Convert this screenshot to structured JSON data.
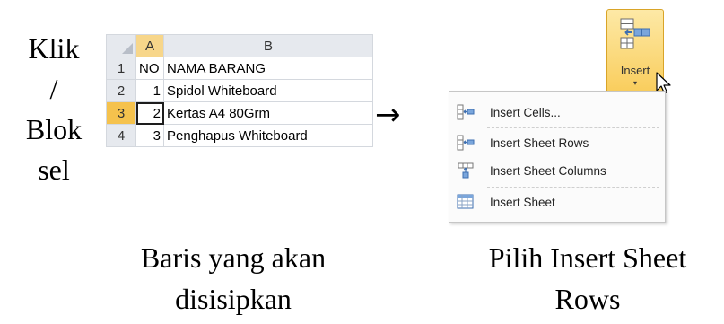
{
  "left_caption": [
    "Klik",
    "/",
    "Blok",
    "sel"
  ],
  "sheet": {
    "columns": [
      "A",
      "B"
    ],
    "rows": [
      {
        "num": "1",
        "a": "NO",
        "b": "NAMA BARANG"
      },
      {
        "num": "2",
        "a": "1",
        "b": "Spidol Whiteboard"
      },
      {
        "num": "3",
        "a": "2",
        "b": "Kertas A4 80Grm"
      },
      {
        "num": "4",
        "a": "3",
        "b": "Penghapus Whiteboard"
      }
    ],
    "selected_row": "3",
    "selected_column": "A"
  },
  "arrow": "→",
  "insert_button": {
    "label": "Insert",
    "dropdown_glyph": "▾"
  },
  "menu": {
    "items": [
      {
        "label": "Insert Cells...",
        "icon": "insert-cells-icon"
      },
      {
        "label": "Insert Sheet Rows",
        "icon": "insert-rows-icon"
      },
      {
        "label": "Insert Sheet Columns",
        "icon": "insert-columns-icon"
      },
      {
        "label": "Insert Sheet",
        "icon": "insert-sheet-icon"
      }
    ]
  },
  "captions": {
    "middle": [
      "Baris yang akan",
      "disisipkan"
    ],
    "right": [
      "Pilih Insert Sheet",
      "Rows"
    ]
  },
  "colors": {
    "selection_header": "#f5c24d",
    "button_gradient_top": "#fde9a6",
    "button_gradient_bottom": "#f9cd5c",
    "icon_blue": "#4a7fc1"
  }
}
